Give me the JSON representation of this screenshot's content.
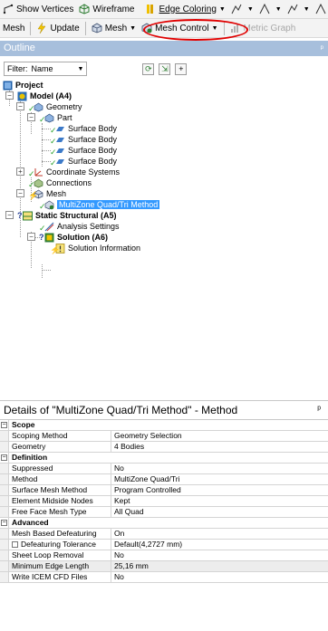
{
  "toolbar1": {
    "show_vertices": "Show Vertices",
    "wireframe": "Wireframe",
    "edge_coloring": "Edge Coloring",
    "tool_icons": [
      "edge-tool-icon",
      "edge-tool-icon",
      "edge-tool-icon",
      "edge-tool-icon"
    ]
  },
  "toolbar2": {
    "mesh": "Mesh",
    "update": "Update",
    "mesh_menu": "Mesh",
    "mesh_control": "Mesh Control",
    "metric_graph": "Metric Graph"
  },
  "outline": {
    "title": "Outline",
    "filter_label": "Filter:",
    "filter_value": "Name",
    "tree": {
      "project": "Project",
      "model": "Model (A4)",
      "geometry": "Geometry",
      "part": "Part",
      "surface_bodies": [
        "Surface Body",
        "Surface Body",
        "Surface Body",
        "Surface Body"
      ],
      "coordinate_systems": "Coordinate Systems",
      "connections": "Connections",
      "mesh": "Mesh",
      "multizone": "MultiZone Quad/Tri Method",
      "static_structural": "Static Structural (A5)",
      "analysis_settings": "Analysis Settings",
      "solution": "Solution (A6)",
      "solution_information": "Solution Information"
    }
  },
  "details": {
    "title": "Details of \"MultiZone Quad/Tri Method\" - Method",
    "sections": [
      {
        "name": "Scope",
        "rows": [
          {
            "key": "Scoping Method",
            "value": "Geometry Selection"
          },
          {
            "key": "Geometry",
            "value": "4 Bodies"
          }
        ]
      },
      {
        "name": "Definition",
        "rows": [
          {
            "key": "Suppressed",
            "value": "No"
          },
          {
            "key": "Method",
            "value": "MultiZone Quad/Tri"
          },
          {
            "key": "Surface Mesh Method",
            "value": "Program Controlled"
          },
          {
            "key": "Element Midside Nodes",
            "value": "Kept"
          },
          {
            "key": "Free Face Mesh Type",
            "value": "All Quad"
          }
        ]
      },
      {
        "name": "Advanced",
        "rows": [
          {
            "key": "Mesh Based Defeaturing",
            "value": "On"
          },
          {
            "key": "Defeaturing Tolerance",
            "value": "Default(4,2727 mm)"
          },
          {
            "key": "Sheet Loop Removal",
            "value": "No"
          },
          {
            "key": "Minimum Edge Length",
            "value": "25,16 mm"
          },
          {
            "key": "Write ICEM CFD Files",
            "value": "No"
          }
        ]
      }
    ]
  },
  "colors": {
    "panel_header": "#a7bfdc",
    "selection": "#3399ff",
    "annotation_circle": "#e00000"
  }
}
